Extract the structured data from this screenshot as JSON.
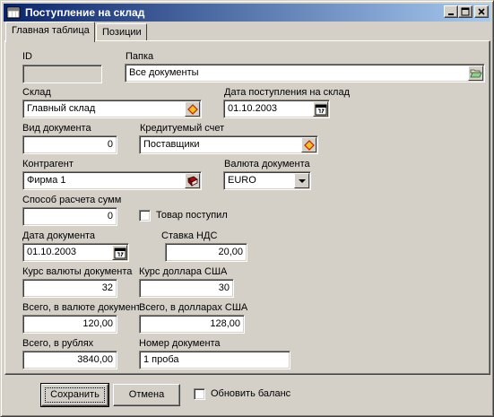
{
  "window": {
    "title": "Поступление на склад",
    "title_bar_color": "#0a246a"
  },
  "tabs": [
    {
      "label": "Главная таблица",
      "active": true
    },
    {
      "label": "Позиции",
      "active": false
    }
  ],
  "form": {
    "id": {
      "label": "ID",
      "value": ""
    },
    "folder": {
      "label": "Папка",
      "value": "Все документы"
    },
    "warehouse": {
      "label": "Склад",
      "value": "Главный склад"
    },
    "receipt_date": {
      "label": "Дата поступления на склад",
      "value": "01.10.2003"
    },
    "doc_type": {
      "label": "Вид документа",
      "value": "0"
    },
    "credit_account": {
      "label": "Кредитуемый счет",
      "value": "Поставщики"
    },
    "counterparty": {
      "label": "Контрагент",
      "value": "Фирма 1"
    },
    "currency": {
      "label": "Валюта документа",
      "value": "EURO"
    },
    "calc_method": {
      "label": "Способ расчета сумм",
      "value": "0"
    },
    "goods_received": {
      "label": "Товар поступил",
      "checked": false
    },
    "doc_date": {
      "label": "Дата документа",
      "value": "01.10.2003"
    },
    "vat_rate": {
      "label": "Ставка НДС",
      "value": "20,00"
    },
    "doc_currency_rate": {
      "label": "Курс валюты документа",
      "value": "32"
    },
    "usd_rate": {
      "label": "Курс доллара США",
      "value": "30"
    },
    "total_doc_currency": {
      "label": "Всего, в валюте документа",
      "value": "120,00"
    },
    "total_usd": {
      "label": "Всего, в долларах США",
      "value": "128,00"
    },
    "total_rub": {
      "label": "Всего, в рублях",
      "value": "3840,00"
    },
    "doc_number": {
      "label": "Номер документа",
      "value": "1 проба"
    }
  },
  "footer": {
    "save_label": "Сохранить",
    "cancel_label": "Отмена",
    "update_balance_label": "Обновить баланс",
    "update_balance_checked": false
  },
  "icons": {
    "folder_button": "open-folder-icon",
    "lookup_button": "lookup-diamond-icon",
    "calendar_button": "calendar-icon",
    "book_button": "book-icon",
    "dropdown": "chevron-down-icon"
  }
}
